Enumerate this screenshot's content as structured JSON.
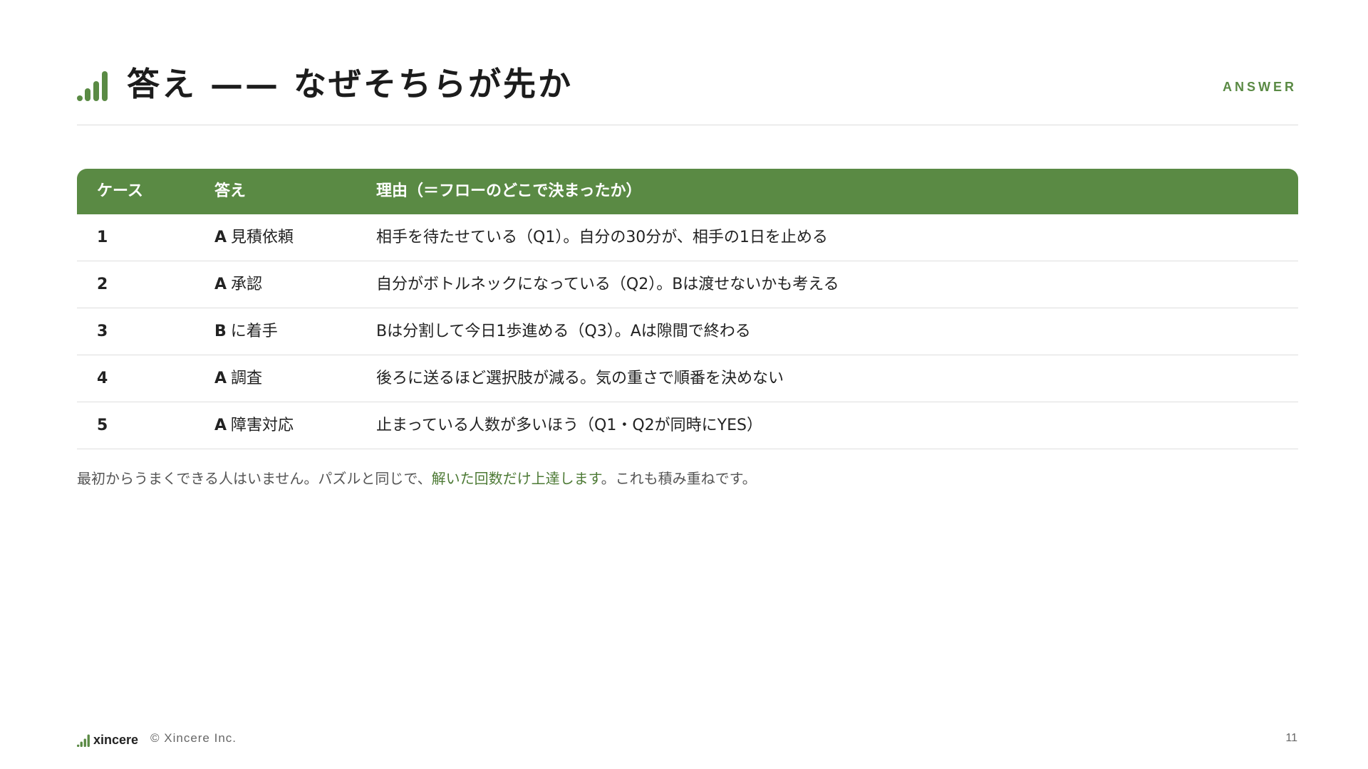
{
  "header": {
    "title": "答え —— なぜそちらが先か",
    "tag": "ANSWER",
    "logo_icon": "signal-bars-icon"
  },
  "colors": {
    "accent": "#5a8a44",
    "highlight_text": "#4d7a35"
  },
  "table": {
    "headers": [
      "ケース",
      "答え",
      "理由（＝フローのどこで決まったか）"
    ],
    "rows": [
      {
        "case": "1",
        "answer_letter": "A",
        "answer_text": "見積依頼",
        "reason": "相手を待たせている（Q1）。自分の30分が、相手の1日を止める"
      },
      {
        "case": "2",
        "answer_letter": "A",
        "answer_text": "承認",
        "reason": "自分がボトルネックになっている（Q2）。Bは渡せないかも考える"
      },
      {
        "case": "3",
        "answer_letter": "B",
        "answer_text": "に着手",
        "reason": "Bは分割して今日1歩進める（Q3）。Aは隙間で終わる"
      },
      {
        "case": "4",
        "answer_letter": "A",
        "answer_text": "調査",
        "reason": "後ろに送るほど選択肢が減る。気の重さで順番を決めない"
      },
      {
        "case": "5",
        "answer_letter": "A",
        "answer_text": "障害対応",
        "reason": "止まっている人数が多いほう（Q1・Q2が同時にYES）"
      }
    ]
  },
  "note": {
    "before": "最初からうまくできる人はいません。パズルと同じで、",
    "highlight": "解いた回数だけ上達します",
    "after": "。これも積み重ねです。"
  },
  "footer": {
    "brand": "xincere",
    "copyright": "© Xincere Inc.",
    "page_number": "11"
  }
}
